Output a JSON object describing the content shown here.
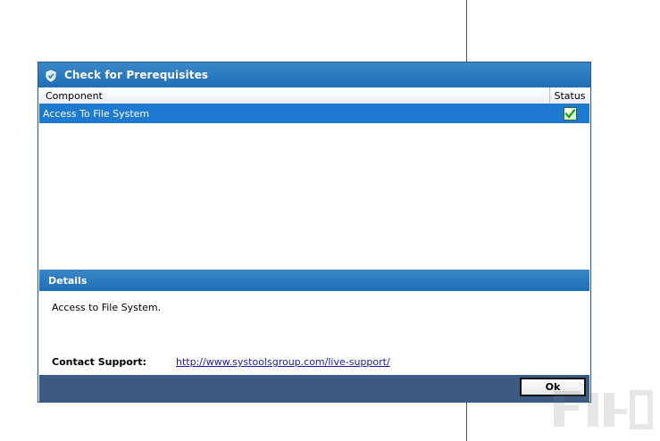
{
  "dialog": {
    "title": "Check for Prerequisites",
    "accent_color": "#1f6fb5",
    "footer_color": "#3c5a84"
  },
  "grid": {
    "columns": [
      "Component",
      "Status"
    ],
    "rows": [
      {
        "component": "Access To File System",
        "status_icon": "check-icon",
        "selected": true
      }
    ]
  },
  "details": {
    "header": "Details",
    "text": "Access to File System.",
    "contact_label": "Contact Support:",
    "contact_link": "http://www.systoolsgroup.com/live-support/"
  },
  "buttons": {
    "ok": "Ok"
  }
}
